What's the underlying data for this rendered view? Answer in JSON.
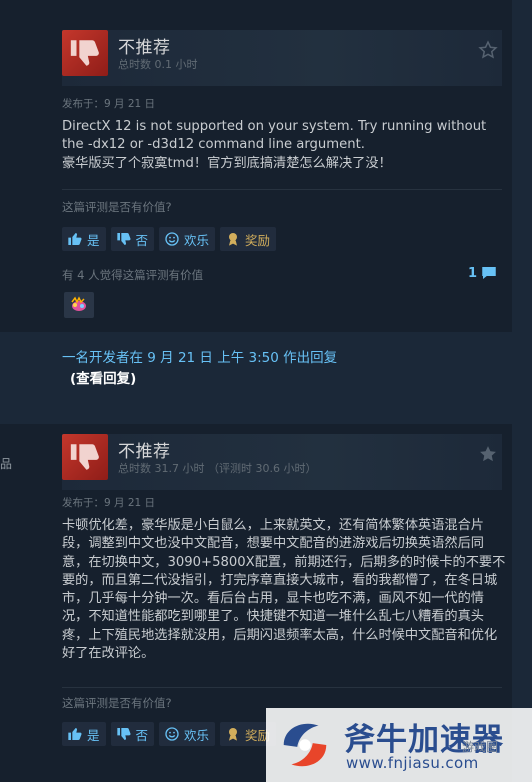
{
  "colors": {
    "page_bg": "#1b2838",
    "card_bg": "#16202d",
    "accent": "#67c1f5",
    "thumb_down_bg": "#c4372c",
    "award_gold": "#d2ae5c",
    "watermark_blue": "#2a4d8f"
  },
  "reviews": [
    {
      "verdict": "不推荐",
      "hours": "总时数 0.1 小时",
      "posted": "发布于：9 月 21 日",
      "body": "DirectX 12 is not supported on your system. Try running without the -dx12 or -d3d12 command line argument.\n豪华版买了个寂寞tmd！官方到底搞清楚怎么解决了没！",
      "helpful_question": "这篇评测是否有价值?",
      "buttons": {
        "yes": "是",
        "no": "否",
        "funny": "欢乐",
        "award": "奖励"
      },
      "found_helpful": "有 4 人觉得这篇评测有价值",
      "comment_count": "1",
      "developer_response": "一名开发者在 9 月 21 日 上午 3:50 作出回复",
      "view_reply": "(查看回复)",
      "icons": [
        "thumbs-down-icon",
        "star-icon",
        "comment-icon",
        "award-badge-icon"
      ]
    },
    {
      "verdict": "不推荐",
      "hours": "总时数 31.7 小时 （评测时 30.6 小时）",
      "posted": "发布于：9 月 21 日",
      "body": "卡顿优化差，豪华版是小白鼠么，上来就英文，还有简体繁体英语混合片段，调整到中文也没中文配音，想要中文配音的进游戏后切换英语然后同意，在切换中文，3090+5800X配置，前期还行，后期多的时候卡的不要不要的，而且第二代没指引，打完序章直接大城市，看的我都懵了，在冬日城市，几乎每十分钟一次。看后台占用，显卡也吃不满，画风不如一代的情况，不知道性能都吃到哪里了。快捷键不知道一堆什么乱七八糟看的真头疼，上下殖民地选择就没用，后期闪退频率太高，什么时候中文配音和优化好了在改评论。",
      "helpful_question": "这篇评测是否有价值?",
      "buttons": {
        "yes": "是",
        "no": "否",
        "funny": "欢乐",
        "award": "奖励"
      },
      "icons": [
        "thumbs-down-icon",
        "star-icon"
      ]
    }
  ],
  "left_fragment": "品",
  "watermark": {
    "name": "斧牛加速器",
    "url": "www.fnjiasu.com",
    "tag": "游戏圈"
  }
}
